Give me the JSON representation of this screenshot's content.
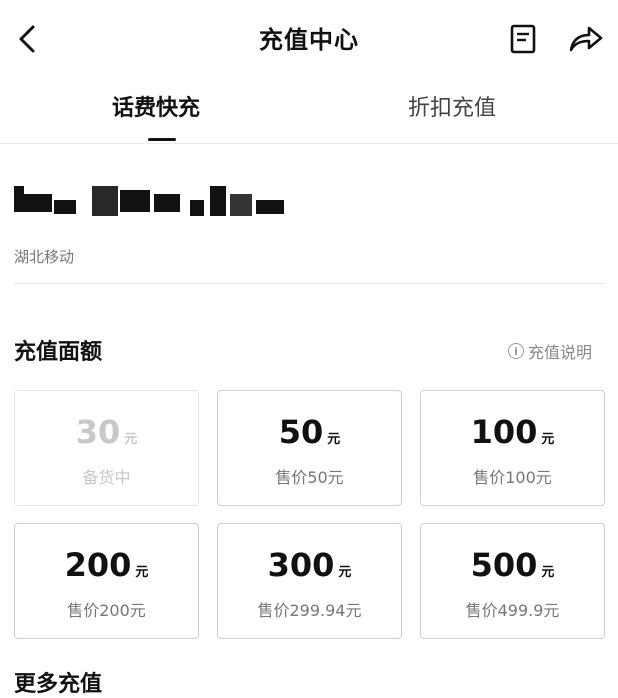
{
  "nav": {
    "title": "充值中心",
    "icons": {
      "back": "chevron-left-icon",
      "bill": "document-icon",
      "share": "share-icon"
    }
  },
  "tabs": [
    {
      "label": "话费快充",
      "active": true
    },
    {
      "label": "折扣充值",
      "active": false
    }
  ],
  "account": {
    "carrier": "湖北移动"
  },
  "denominations": {
    "title": "充值面额",
    "help_label": "充值说明",
    "unit": "元",
    "cards": [
      {
        "amount": "30",
        "price": "备货中",
        "disabled": true
      },
      {
        "amount": "50",
        "price": "售价50元",
        "disabled": false
      },
      {
        "amount": "100",
        "price": "售价100元",
        "disabled": false
      },
      {
        "amount": "200",
        "price": "售价200元",
        "disabled": false
      },
      {
        "amount": "300",
        "price": "售价299.94元",
        "disabled": false
      },
      {
        "amount": "500",
        "price": "售价499.9元",
        "disabled": false
      }
    ]
  },
  "more": {
    "title": "更多充值"
  },
  "colors": {
    "text": "#111111",
    "muted": "#777777",
    "border": "#cfcfcf",
    "disabled": "#c8c8c8"
  }
}
